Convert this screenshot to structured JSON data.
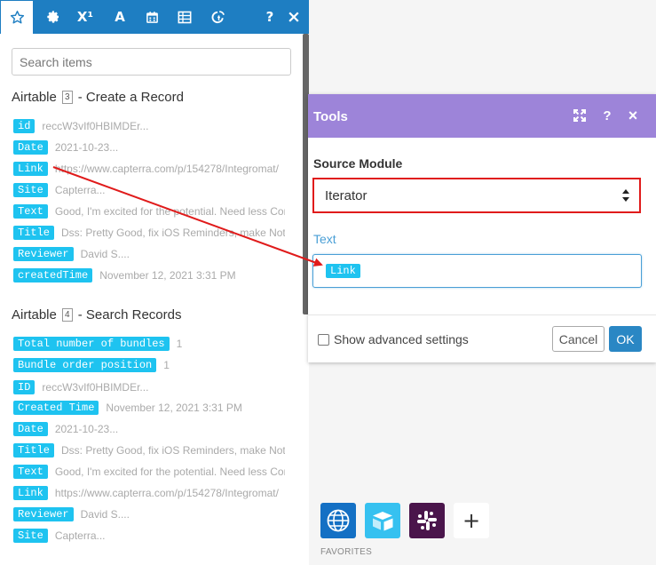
{
  "left_panel": {
    "tabs": [
      {
        "name": "favorites",
        "icon": "star-icon"
      },
      {
        "name": "general",
        "icon": "gear-icon"
      },
      {
        "name": "math",
        "icon": "superscript-icon",
        "label": "X¹"
      },
      {
        "name": "text",
        "icon": "text-icon",
        "label": "A"
      },
      {
        "name": "date",
        "icon": "calendar-icon"
      },
      {
        "name": "array",
        "icon": "table-icon"
      },
      {
        "name": "custom",
        "icon": "custom-function-icon"
      },
      {
        "name": "help",
        "icon": "question-icon",
        "label": "?"
      },
      {
        "name": "close",
        "icon": "close-icon",
        "label": "×"
      }
    ],
    "search": {
      "placeholder": "Search items"
    },
    "groups": [
      {
        "app": "Airtable",
        "module_number": "3",
        "title_suffix": "- Create a Record",
        "items": [
          {
            "key": "id",
            "value": "reccW3vIf0HBIMDEr..."
          },
          {
            "key": "Date",
            "value": "2021-10-23..."
          },
          {
            "key": "Link",
            "value": "https://www.capterra.com/p/154278/Integromat/"
          },
          {
            "key": "Site",
            "value": "Capterra..."
          },
          {
            "key": "Text",
            "value": "Good, I'm excited for the potential. Need less Com"
          },
          {
            "key": "Title",
            "value": "Dss: Pretty Good, fix iOS Reminders, make Notio"
          },
          {
            "key": "Reviewer",
            "value": "David S...."
          },
          {
            "key": "createdTime",
            "value": "November 12, 2021 3:31 PM"
          }
        ]
      },
      {
        "app": "Airtable",
        "module_number": "4",
        "title_suffix": "- Search Records",
        "items": [
          {
            "key": "Total number of bundles",
            "value": "1"
          },
          {
            "key": "Bundle order position",
            "value": "1"
          },
          {
            "key": "ID",
            "value": "reccW3vIf0HBIMDEr..."
          },
          {
            "key": "Created Time",
            "value": "November 12, 2021 3:31 PM"
          },
          {
            "key": "Date",
            "value": "2021-10-23..."
          },
          {
            "key": "Title",
            "value": "Dss: Pretty Good, fix iOS Reminders, make Notio"
          },
          {
            "key": "Text",
            "value": "Good, I'm excited for the potential. Need less Com"
          },
          {
            "key": "Link",
            "value": "https://www.capterra.com/p/154278/Integromat/"
          },
          {
            "key": "Reviewer",
            "value": "David S...."
          },
          {
            "key": "Site",
            "value": "Capterra..."
          }
        ]
      }
    ]
  },
  "tools_dialog": {
    "title": "Tools",
    "header_icons": [
      "expand-icon",
      "help-icon",
      "close-icon"
    ],
    "help_label": "?",
    "close_label": "×",
    "source_module_label": "Source Module",
    "source_module_value": "Iterator",
    "text_label": "Text",
    "text_value_pill": "Link",
    "advanced_settings_label": "Show advanced settings",
    "cancel_label": "Cancel",
    "ok_label": "OK"
  },
  "favorites": {
    "label": "FAVORITES",
    "items": [
      "globe-icon",
      "airtable-icon",
      "slack-icon",
      "plus-icon"
    ],
    "add_label": "+"
  },
  "colors": {
    "tab_bar": "#1e7ec2",
    "pill": "#1ec3f0",
    "dialog_header": "#9d84d9",
    "highlight": "#e01b1b",
    "ok_button": "#2a87c4"
  }
}
